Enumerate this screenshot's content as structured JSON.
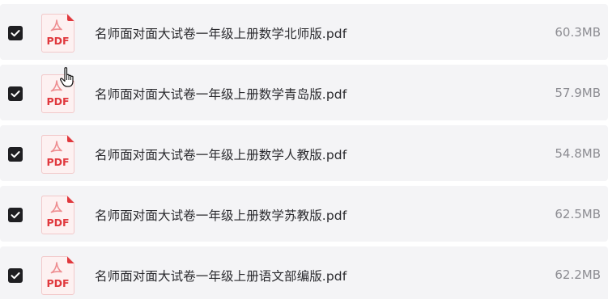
{
  "files": [
    {
      "name": "名师面对面大试卷一年级上册数学北师版.pdf",
      "size": "60.3MB",
      "checked": true,
      "icon": "pdf-file-icon",
      "icon_label": "PDF"
    },
    {
      "name": "名师面对面大试卷一年级上册数学青岛版.pdf",
      "size": "57.9MB",
      "checked": true,
      "icon": "pdf-file-icon",
      "icon_label": "PDF"
    },
    {
      "name": "名师面对面大试卷一年级上册数学人教版.pdf",
      "size": "54.8MB",
      "checked": true,
      "icon": "pdf-file-icon",
      "icon_label": "PDF"
    },
    {
      "name": "名师面对面大试卷一年级上册数学苏教版.pdf",
      "size": "62.5MB",
      "checked": true,
      "icon": "pdf-file-icon",
      "icon_label": "PDF"
    },
    {
      "name": "名师面对面大试卷一年级上册语文部编版.pdf",
      "size": "62.2MB",
      "checked": true,
      "icon": "pdf-file-icon",
      "icon_label": "PDF"
    }
  ],
  "colors": {
    "row_background": "#f4f4f6",
    "checkbox": "#1f1f22",
    "pdf_red": "#e0383d",
    "text": "#2a2a2e",
    "size_text": "#8c8c92"
  },
  "cursor": {
    "icon": "hand-pointer-icon"
  }
}
